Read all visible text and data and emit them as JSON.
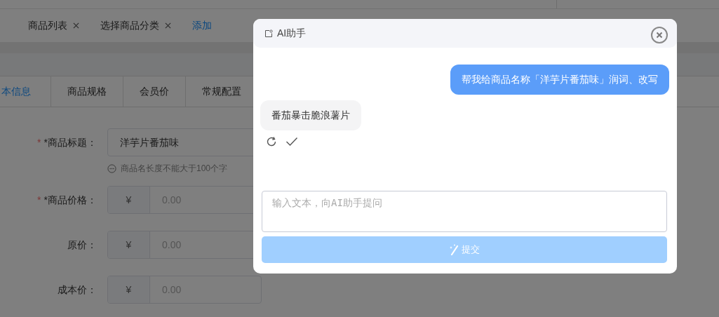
{
  "page_tabs": [
    {
      "label": "商品列表",
      "closable": true,
      "selected": false
    },
    {
      "label": "选择商品分类",
      "closable": true,
      "selected": false
    },
    {
      "label": "添加",
      "closable": false,
      "selected": true
    }
  ],
  "form_tabs": [
    {
      "label": "本信息",
      "selected": true
    },
    {
      "label": "商品规格",
      "selected": false
    },
    {
      "label": "会员价",
      "selected": false
    },
    {
      "label": "常规配置",
      "selected": false
    }
  ],
  "fields": [
    {
      "kind": "text",
      "mark": "*",
      "label": "*商品标题：",
      "value": "洋芋片番茄味",
      "hint": "商品名长度不能大于100个字"
    },
    {
      "kind": "price",
      "mark": "*",
      "label": "*商品价格：",
      "prefix": "¥",
      "placeholder": "0.00"
    },
    {
      "kind": "price",
      "label": "原价：",
      "prefix": "¥",
      "placeholder": "0.00"
    },
    {
      "kind": "price",
      "label": "成本价：",
      "prefix": "¥",
      "placeholder": "0.00"
    }
  ],
  "dialog": {
    "title": "AI助手",
    "messages": [
      {
        "kind": "user",
        "text": "帮我给商品名称「洋芋片番茄味」润词、改写"
      },
      {
        "kind": "assistant",
        "text": "番茄暴击脆浪薯片"
      }
    ],
    "input": {
      "placeholder": "输入文本，向AI助手提问"
    },
    "submit": {
      "label": "提交",
      "disabled": true
    }
  }
}
